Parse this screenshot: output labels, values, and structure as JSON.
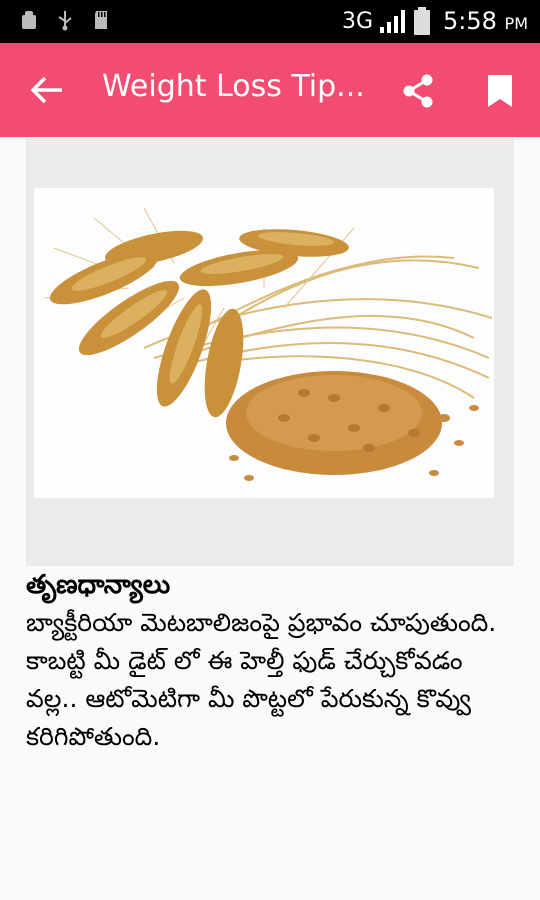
{
  "status_bar": {
    "network": "3G",
    "time": "5:58",
    "ampm": "PM",
    "icons": [
      "android-debug-icon",
      "usb-icon",
      "sd-card-icon",
      "signal-icon",
      "battery-icon"
    ]
  },
  "app_bar": {
    "title": "Weight Loss Tip...",
    "background_color": "#f24d70",
    "icons": [
      "back-arrow-icon",
      "share-icon",
      "bookmark-icon"
    ]
  },
  "article": {
    "image": "wheat-grains-photo",
    "heading": "తృణధాన్యాలు",
    "body": "బ్యాక్టీరియా మెటబాలిజంపై ప్రభావం చూపుతుంది. కాబట్టి మీ డైట్ లో ఈ హెల్తీ ఫుడ్ చేర్చుకోవడం వల్ల.. ఆటోమెటిగా మీ పొట్టలో పేరుకున్న కొవ్వు కరిగిపోతుంది."
  }
}
